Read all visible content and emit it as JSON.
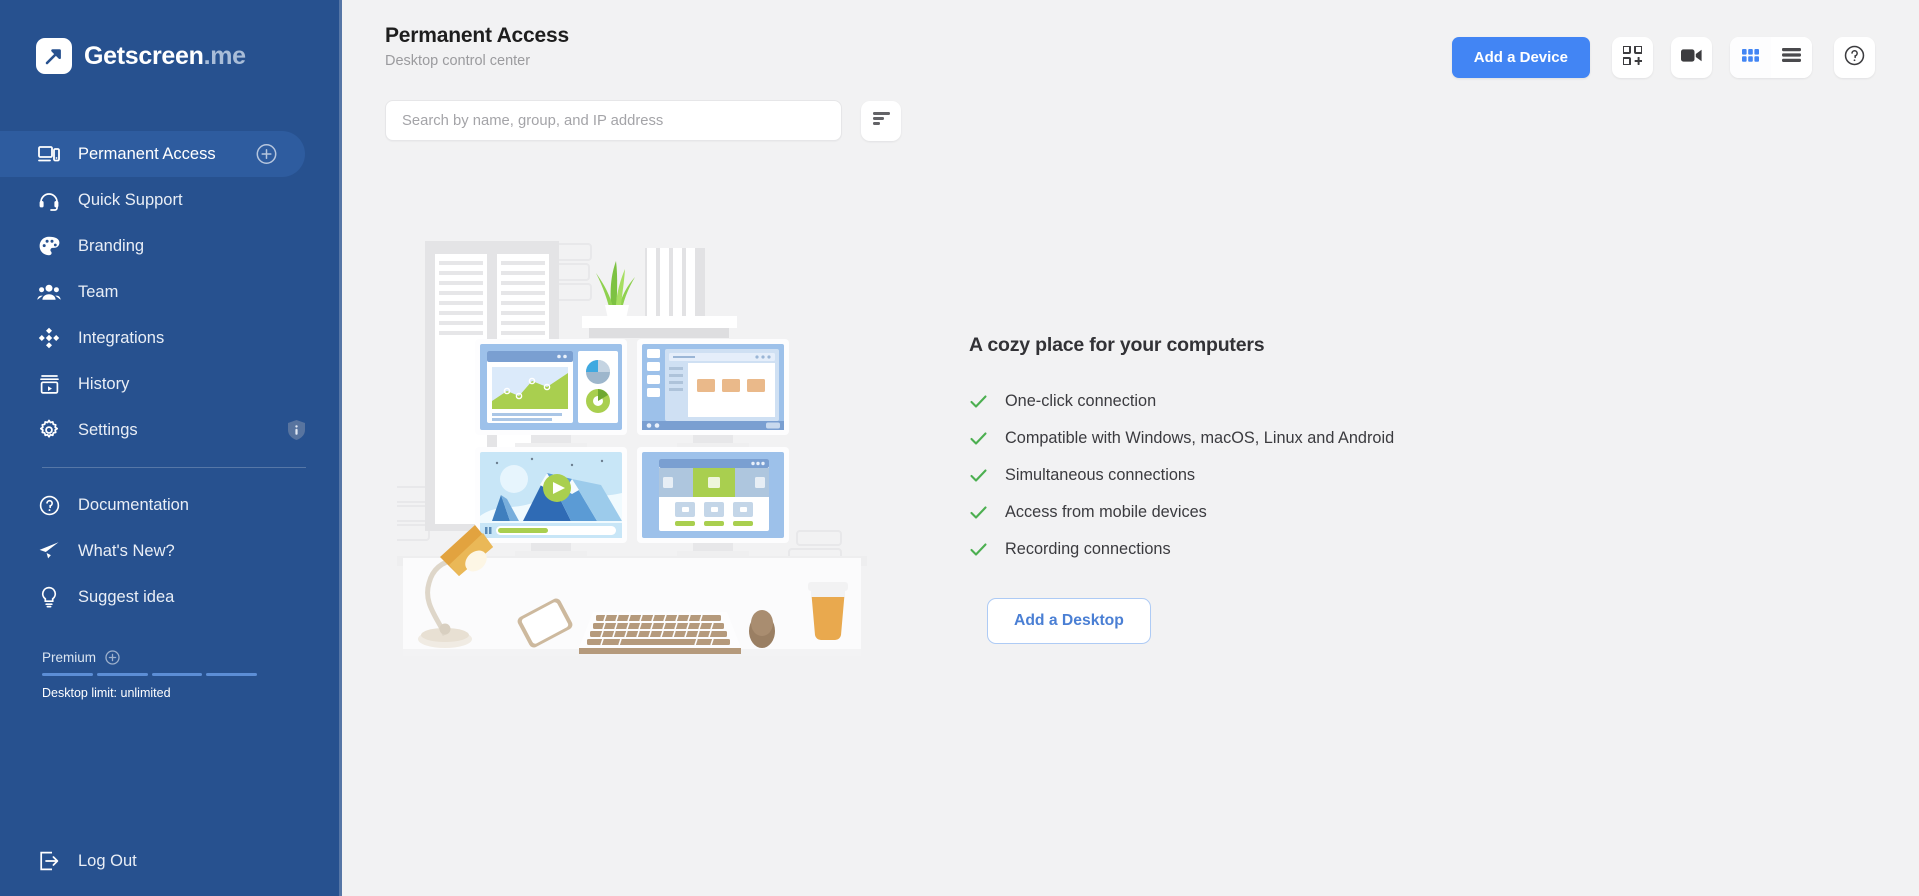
{
  "brand": {
    "name": "Getscreen",
    "suffix": ".me",
    "logo_icon": "arrow-up-right-logo"
  },
  "sidebar": {
    "primary_items": [
      {
        "label": "Permanent Access",
        "icon": "monitor-device-icon",
        "active": true,
        "badge": "plus-circle-icon"
      },
      {
        "label": "Quick Support",
        "icon": "headset-icon",
        "active": false
      },
      {
        "label": "Branding",
        "icon": "palette-icon",
        "active": false
      },
      {
        "label": "Team",
        "icon": "people-icon",
        "active": false
      },
      {
        "label": "Integrations",
        "icon": "integrations-diamond-icon",
        "active": false
      },
      {
        "label": "History",
        "icon": "history-archive-icon",
        "active": false
      },
      {
        "label": "Settings",
        "icon": "gear-icon",
        "active": false,
        "badge": "shield-info-icon"
      }
    ],
    "secondary_items": [
      {
        "label": "Documentation",
        "icon": "question-circle-icon"
      },
      {
        "label": "What's New?",
        "icon": "paper-plane-icon"
      },
      {
        "label": "Suggest idea",
        "icon": "lightbulb-icon"
      }
    ],
    "premium": {
      "label": "Premium",
      "plus_icon": "plus-circle-icon",
      "segments": 4,
      "note": "Desktop limit: unlimited"
    },
    "logout": {
      "label": "Log Out",
      "icon": "logout-icon"
    }
  },
  "header": {
    "title": "Permanent Access",
    "subtitle": "Desktop control center",
    "add_device_label": "Add a Device",
    "qr_icon": "qr-code-plus-icon",
    "video_icon": "video-camera-icon",
    "grid_view_icon": "grid-view-icon",
    "list_view_icon": "list-view-icon",
    "help_icon": "question-circle-icon",
    "active_view": "grid"
  },
  "search": {
    "placeholder": "Search by name, group, and IP address",
    "value": "",
    "filter_icon": "sort-filter-icon"
  },
  "empty_state": {
    "illustration": "desk-with-monitors-illustration",
    "title": "A cozy place for your computers",
    "features": [
      "One-click connection",
      "Compatible with Windows, macOS, Linux and Android",
      "Simultaneous connections",
      "Access from mobile devices",
      "Recording connections"
    ],
    "check_icon": "check-mark-icon",
    "cta_label": "Add a Desktop"
  },
  "colors": {
    "sidebar_bg": "#27518f",
    "sidebar_active": "#2e5c9f",
    "accent_blue": "#4285f4",
    "page_bg": "#f2f2f3",
    "check_green": "#4caf50",
    "outline_blue": "#4a7fd4"
  }
}
